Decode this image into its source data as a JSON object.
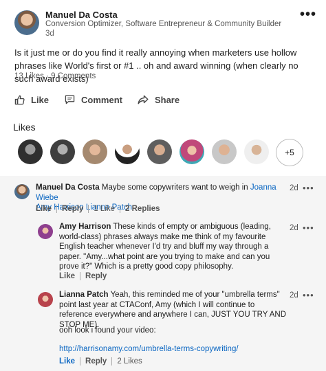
{
  "post": {
    "author_name": "Manuel Da Costa",
    "author_headline": "Conversion Optimizer, Software Entrepreneur & Community Builder",
    "time": "3d",
    "more_menu": "•••",
    "text": "Is it just me or do you find it really annoying when marketers use hollow phrases like World's first or #1 .. oh and award winning (when clearly no such award exists)",
    "likes_count": "13 Likes",
    "dot": " · ",
    "comments_count": "9 Comments"
  },
  "actions": {
    "like": "Like",
    "comment": "Comment",
    "share": "Share"
  },
  "likes_section": {
    "title": "Likes",
    "more": "+5",
    "liker_colors": [
      "#3a3a3a",
      "#505050",
      "#c89a7c",
      "#2b2b2b",
      "#6f6f6f",
      "#c0487a",
      "#b9886a",
      "#8a8a8a"
    ]
  },
  "comments": [
    {
      "author": "Manuel Da Costa",
      "text": " Maybe some copywriters want to weigh in ",
      "mention1": "Joanna Wiebe",
      "mention2": "Amy Harrison",
      "mention3": "Lianna Patch",
      "time": "2d",
      "dots": "•••",
      "like": "Like",
      "reply": "Reply",
      "likes": "1 Like",
      "replies": "2 Replies"
    },
    {
      "author": "Amy Harrison",
      "text": " These kinds of empty or ambiguous (leading, world-class) phrases always make me think of my favourite English teacher whenever I'd try and bluff my way through a paper. \"Amy...what point are you trying to make and can you prove it?\" Which is a pretty good copy philosophy.",
      "time": "2d",
      "dots": "•••",
      "like": "Like",
      "reply": "Reply"
    },
    {
      "author": "Lianna Patch",
      "text": " Yeah, this reminded me of your \"umbrella terms\" point last year at CTAConf, Amy (which I will continue to reference everywhere and anywhere I can, JUST YOU TRY AND STOP ME).",
      "text2": "ooh look i found your video:",
      "link": "http://harrisonamy.com/umbrella-terms-copywriting/",
      "time": "2d",
      "dots": "•••",
      "like": "Like",
      "reply": "Reply",
      "likes": "2 Likes"
    }
  ]
}
